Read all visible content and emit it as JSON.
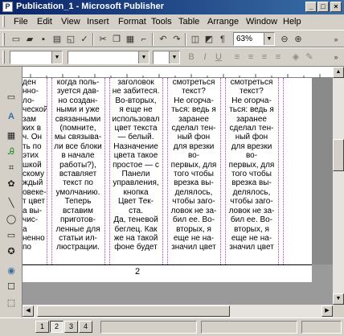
{
  "window": {
    "title": "Publication_1 - Microsoft Publisher",
    "minimize": "_",
    "maximize": "□",
    "close": "×"
  },
  "menu": [
    "File",
    "Edit",
    "View",
    "Insert",
    "Format",
    "Tools",
    "Table",
    "Arrange",
    "Window",
    "Help"
  ],
  "toolbar": {
    "zoom_value": "63%",
    "font_name_value": "",
    "font_size_value": "",
    "icons": [
      "new-icon",
      "open-icon",
      "save-icon",
      "print-icon",
      "print-preview-icon",
      "spelling-icon",
      "cut-icon",
      "copy-icon",
      "paste-icon",
      "format-painter-icon",
      "undo-icon",
      "redo-icon",
      "bring-forward-icon",
      "send-backward-icon",
      "show-hide-icon",
      "zoom-out-icon",
      "zoom-in-icon"
    ]
  },
  "columns": [
    [
      "ден",
      "нно-",
      "ло-",
      "ческой",
      "зам",
      "ких в",
      "ч. Он",
      "ть по",
      "этих",
      "шкой",
      "скому",
      "ждый",
      "овеке-",
      "т цвет",
      "а вы-",
      "чис-",
      "а",
      "ненно",
      "по"
    ],
    [
      "когда поль-",
      "зуется дав-",
      "но создан-",
      "ными и уже",
      "связанными",
      "(помните,",
      "мы связыва-",
      "ли все блоки",
      "в начале",
      "работы?),",
      "вставляет",
      "текст по",
      "умолчанию.",
      "Теперь",
      "вставим",
      "приготов-",
      "ленные для",
      "статьи ил-",
      "люстрации."
    ],
    [
      "заголовок",
      "не забитеся.",
      "Во-вторых,",
      "я еще не",
      "использовал",
      "цвет текста",
      "— белый.",
      "Назначение",
      "цвета такое",
      "простое — с",
      "Панели",
      "управления,",
      "кнопка",
      "Цвет Тек-",
      "ста.",
      "Да, теневой",
      "беглец. Как",
      "же на такой",
      "фоне будет"
    ],
    [
      "смотреться",
      "текст?",
      "Не огорча-",
      "ться: ведь я",
      "заранее",
      "сделал тен-",
      "ный фон",
      "для врезки",
      "во-",
      "первых, для",
      "того чтобы",
      "врезка вы-",
      "делялось,",
      "чтобы заго-",
      "ловок не за-",
      "бил ее. Во-",
      "вторых, я",
      "еще не на-",
      "значил цвет"
    ],
    [
      "смотреться",
      "текст?",
      "Не огорча-",
      "ться: ведь я",
      "заранее",
      "сделал тен-",
      "ный фон",
      "для врезки",
      "во-",
      "первых, для",
      "того чтобы",
      "врезка вы-",
      "делялось,",
      "чтобы заго-",
      "ловок не за-",
      "бил ее. Во-",
      "вторых, я",
      "еще не на-",
      "значил цвет"
    ]
  ],
  "page_number": "2",
  "pages": [
    "1",
    "2",
    "3",
    "4"
  ],
  "active_page": "2"
}
